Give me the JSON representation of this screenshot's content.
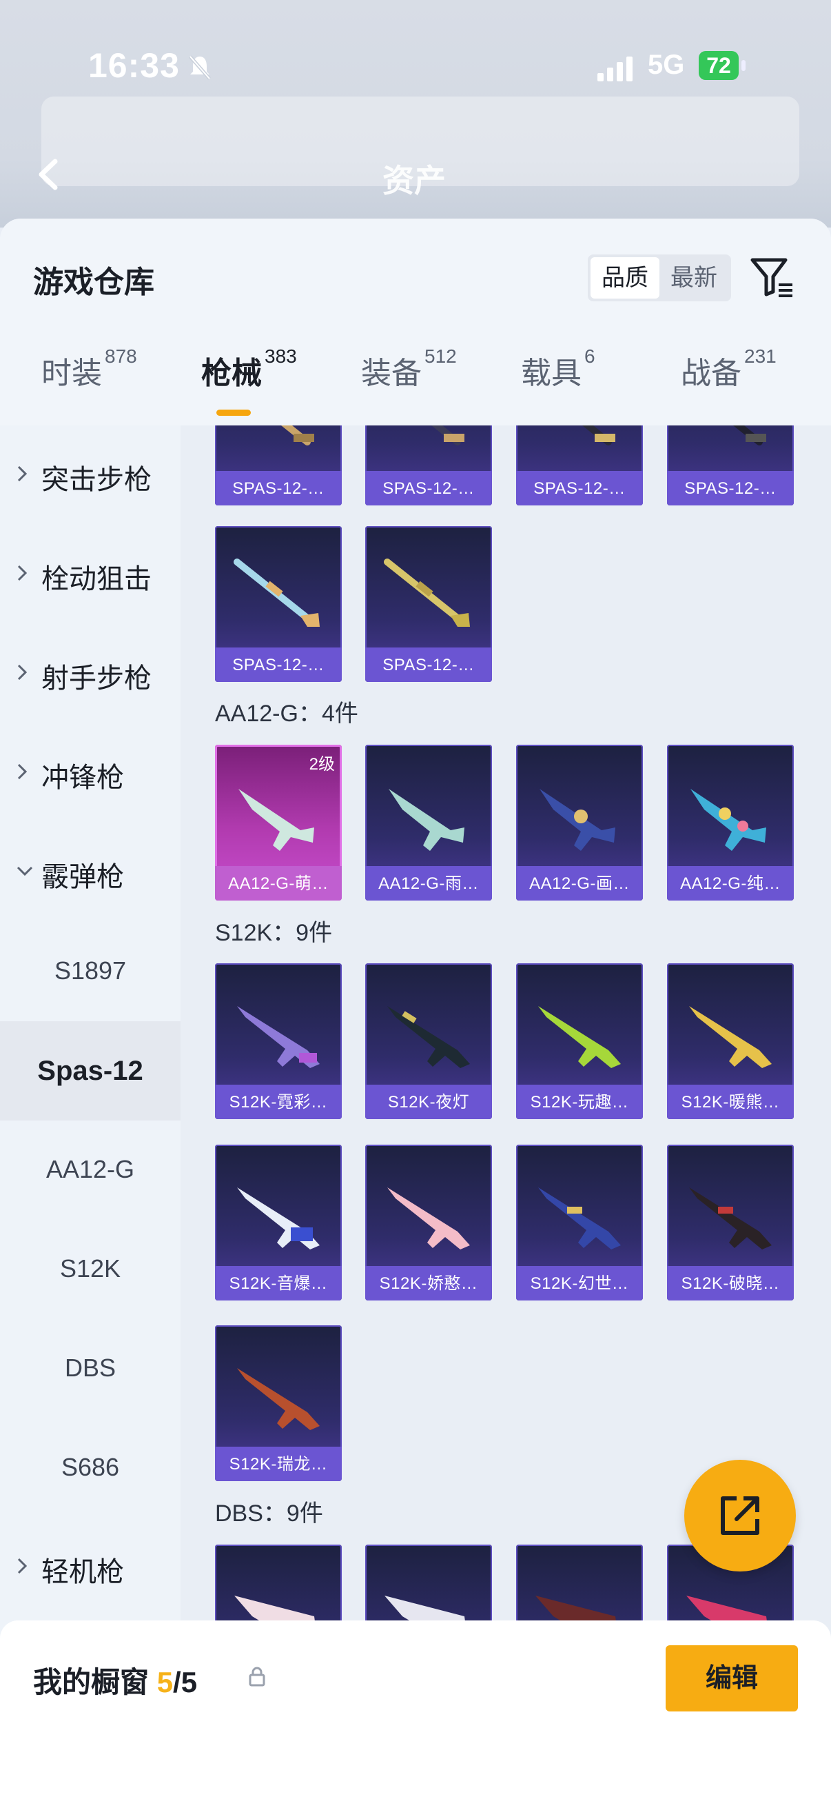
{
  "status": {
    "time": "16:33",
    "network": "5G",
    "battery": "72"
  },
  "nav": {
    "title": "资产"
  },
  "sheet": {
    "title": "游戏仓库",
    "sort": {
      "options": [
        "品质",
        "最新"
      ],
      "selected": "品质"
    },
    "tabs": [
      {
        "label": "时装",
        "count": "878"
      },
      {
        "label": "枪械",
        "count": "383",
        "active": true
      },
      {
        "label": "装备",
        "count": "512"
      },
      {
        "label": "载具",
        "count": "6"
      },
      {
        "label": "战备",
        "count": "231"
      }
    ]
  },
  "sidebar": {
    "items": [
      {
        "label": "突击步枪",
        "expanded": false
      },
      {
        "label": "栓动狙击",
        "expanded": false
      },
      {
        "label": "射手步枪",
        "expanded": false
      },
      {
        "label": "冲锋枪",
        "expanded": false
      },
      {
        "label": "霰弹枪",
        "expanded": true
      }
    ],
    "sub_items": [
      "S1897",
      "Spas-12",
      "AA12-G",
      "S12K",
      "DBS",
      "S686"
    ],
    "active_sub": "Spas-12",
    "last_item": {
      "label": "轻机枪",
      "expanded": false
    }
  },
  "grid": {
    "spas_row1": [
      "SPAS-12-…",
      "SPAS-12-…",
      "SPAS-12-…",
      "SPAS-12-…"
    ],
    "spas_row2": [
      "SPAS-12-…",
      "SPAS-12-…"
    ],
    "aa12": {
      "heading": "AA12-G：4件",
      "items": [
        {
          "name": "AA12-G-萌…",
          "level": "2级"
        },
        {
          "name": "AA12-G-雨…"
        },
        {
          "name": "AA12-G-画…"
        },
        {
          "name": "AA12-G-纯…"
        }
      ]
    },
    "s12k": {
      "heading": "S12K：9件",
      "items": [
        "S12K-霓彩…",
        "S12K-夜灯",
        "S12K-玩趣…",
        "S12K-暖熊…",
        "S12K-音爆…",
        "S12K-娇憨…",
        "S12K-幻世…",
        "S12K-破晓…",
        "S12K-瑞龙…"
      ]
    },
    "dbs": {
      "heading": "DBS：9件"
    }
  },
  "footer": {
    "title": "我的橱窗",
    "used": "5",
    "total": "/5",
    "edit_label": "编辑"
  },
  "colors": {
    "accent": "#f7ac12",
    "card": "#2f2c6a",
    "card_bar": "#6b55d2",
    "pink_card": "#b23bb0"
  },
  "icons": [
    "mute-bell-icon",
    "signal-icon",
    "back-icon",
    "filter-icon",
    "share-icon",
    "lock-icon",
    "chevron-right-icon",
    "chevron-down-icon"
  ]
}
